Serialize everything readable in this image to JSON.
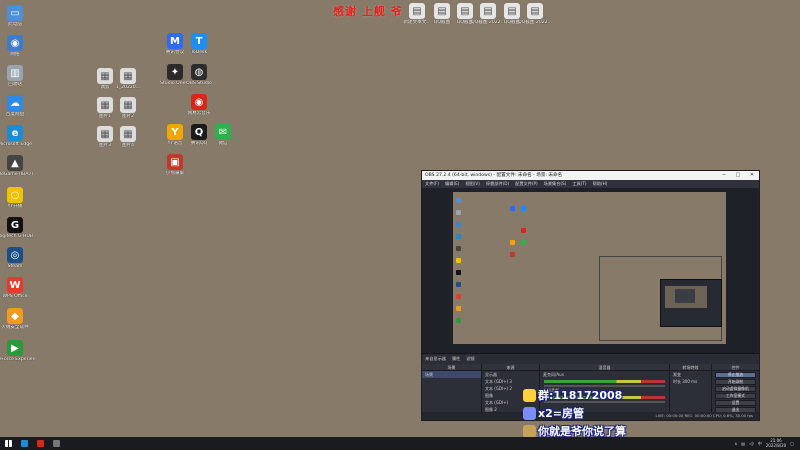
{
  "banner": {
    "text": "感谢 上舰 爷 "
  },
  "desktop_left_icons": [
    {
      "label": "此电脑",
      "color": "#4a8fd8",
      "glyph": "▭"
    },
    {
      "label": "网络",
      "color": "#3c7ccc",
      "glyph": "◉"
    },
    {
      "label": "回收站",
      "color": "#9aa4b0",
      "glyph": "▥"
    },
    {
      "label": "百度网盘",
      "color": "#2e8ae6",
      "glyph": "☁"
    },
    {
      "label": "Microsoft Edge",
      "color": "#1d8bd1",
      "glyph": "e"
    },
    {
      "label": "WeGame (IBA7)",
      "color": "#444",
      "glyph": "▲"
    },
    {
      "label": "YY开播",
      "color": "#f2c200",
      "glyph": "○"
    },
    {
      "label": "Logitech G HUB",
      "color": "#111",
      "glyph": "G"
    },
    {
      "label": "Steam",
      "color": "#1b4f86",
      "glyph": "◎"
    },
    {
      "label": "WPS Office",
      "color": "#e33b2e",
      "glyph": "W"
    },
    {
      "label": "火绒安全软件",
      "color": "#f09a1e",
      "glyph": "◆"
    },
    {
      "label": "GeForce Experience",
      "color": "#2b9a3b",
      "glyph": "▶"
    }
  ],
  "desktop_files": [
    {
      "label": "偶剪",
      "color": "#dcdcdc"
    },
    {
      "label": "1_20220...",
      "color": "#dcdcdc"
    },
    {
      "label": "图片1",
      "color": "#dcdcdc"
    },
    {
      "label": "图片2",
      "color": "#dcdcdc"
    },
    {
      "label": "图片3",
      "color": "#dcdcdc"
    },
    {
      "label": "图片4",
      "color": "#dcdcdc"
    },
    {
      "label": "图片5",
      "color": "#dcdcdc"
    }
  ],
  "desktop_apps": [
    {
      "label": "腾讯会议",
      "color": "#2d6cf0",
      "glyph": "M"
    },
    {
      "label": "ToDesk",
      "color": "#1c8ef2",
      "glyph": "T"
    },
    {
      "label": "Studio One 5",
      "color": "#2a2a2a",
      "glyph": "✦"
    },
    {
      "label": "OBS Studio",
      "color": "#2d2d2d",
      "glyph": "◍"
    },
    {
      "label": "网易云音乐",
      "color": "#d9261c",
      "glyph": "◉"
    },
    {
      "label": "YY语音",
      "color": "#f0a500",
      "glyph": "Y"
    },
    {
      "label": "腾讯QQ",
      "color": "#1b1b1b",
      "glyph": "Q"
    },
    {
      "label": "微信",
      "color": "#2bb24c",
      "glyph": "✉"
    },
    {
      "label": "小熊录屏",
      "color": "#c0392b",
      "glyph": "▣"
    }
  ],
  "desktop_top_icons": [
    {
      "label": "新建文本文...",
      "color": "#e6e6e6"
    },
    {
      "label": "QQ截图",
      "color": "#e6e6e6"
    },
    {
      "label": "QQ截图",
      "color": "#e6e6e6"
    },
    {
      "label": "QQ截图 2022...",
      "color": "#e6e6e6"
    },
    {
      "label": "QQ截图",
      "color": "#e6e6e6"
    },
    {
      "label": "QQ截图 2022...",
      "color": "#e6e6e6"
    }
  ],
  "obs": {
    "title": "OBS 27.2.4 (64-bit, windows) - 配置文件: 未命名 - 场景: 未命名",
    "menu": [
      "文件(F)",
      "编辑(E)",
      "视图(V)",
      "停靠部件(D)",
      "配置文件(P)",
      "场景集合(S)",
      "工具(T)",
      "帮助(H)"
    ],
    "dock_header": [
      "来自显示器",
      "属性",
      "滤镜"
    ],
    "panels": {
      "scenes": {
        "title": "场景",
        "items": [
          "场景"
        ]
      },
      "sources": {
        "title": "来源",
        "items": [
          "显示器",
          "文本 (GDI+) 3",
          "文本 (GDI+) 2",
          "图像",
          "文本 (GDI+)",
          "图像 2"
        ]
      },
      "mixer": {
        "title": "混音器",
        "tracks": [
          "麦克风/Aux",
          "桌面音频"
        ]
      },
      "transitions": {
        "title": "转场特效",
        "items": [
          "渐变",
          "时长 300 ms"
        ]
      },
      "controls": {
        "title": "控件",
        "buttons": [
          "停止推流",
          "开始录制",
          "启动虚拟摄像机",
          "工作室模式",
          "设置",
          "退出"
        ]
      }
    },
    "status": "LIVE: 00:00:00  REC: 00:00:00  CPU: 0.6%, 30.00 fps"
  },
  "overlay": [
    {
      "text": "群:118172008",
      "color": "#ffd23a"
    },
    {
      "text": "x2=房管",
      "color": "#7b8cff"
    },
    {
      "text": "你就是爷你说了算",
      "color": "#c8a25a"
    }
  ],
  "taskbar": {
    "time": "21:06",
    "date": "2022/8/20",
    "apps": [
      {
        "name": "start",
        "color": "#ffffff"
      },
      {
        "name": "edge",
        "color": "#1d8bd1"
      },
      {
        "name": "netease",
        "color": "#d9261c"
      },
      {
        "name": "obs",
        "color": "#777777"
      }
    ]
  }
}
